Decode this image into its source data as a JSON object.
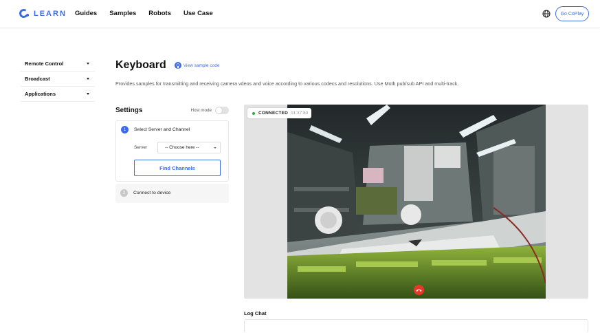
{
  "brand": {
    "name": "LEARN",
    "accent": "#3d6be6"
  },
  "nav": [
    {
      "label": "Guides"
    },
    {
      "label": "Samples"
    },
    {
      "label": "Robots"
    },
    {
      "label": "Use Case"
    }
  ],
  "header": {
    "go_button": "Go CoPlay",
    "globe_icon": "globe-icon"
  },
  "sidebar": {
    "items": [
      {
        "label": "Remote Control"
      },
      {
        "label": "Broadcast"
      },
      {
        "label": "Applications"
      }
    ]
  },
  "page": {
    "title": "Keyboard",
    "sample_link": "View sample code",
    "description": "Provides samples for transmitting and receiving camera vdeos and voice according to various codecs and resolutions. Use Moth pub/sub API and multi-track."
  },
  "settings": {
    "title": "Settings",
    "host_mode_label": "Host mode",
    "host_mode_on": false,
    "steps": [
      {
        "number": "1",
        "label": "Select Server and Channel"
      },
      {
        "number": "2",
        "label": "Connect to device"
      }
    ],
    "server_label": "Server",
    "server_select_value": "-- Choose here --",
    "find_button": "Find Channels"
  },
  "video": {
    "status": "CONNECTED",
    "elapsed": "01:37:80",
    "status_color": "#27b24a",
    "hangup_color": "#e53a2a"
  },
  "log": {
    "title": "Log Chat"
  }
}
